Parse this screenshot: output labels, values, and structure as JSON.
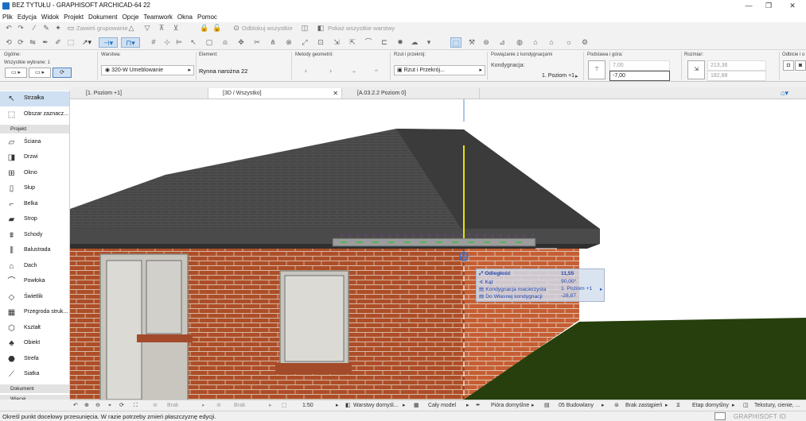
{
  "window": {
    "title": "BEZ TYTUŁU - GRAPHISOFT ARCHICAD-64 22",
    "minimize": "—",
    "maximize": "❐",
    "close": "✕"
  },
  "menu": [
    "Plik",
    "Edycja",
    "Widok",
    "Projekt",
    "Dokument",
    "Opcje",
    "Teamwork",
    "Okna",
    "Pomoc"
  ],
  "toolbar": {
    "group": "Zawieś grupowanie",
    "unlock": "Odblokuj wszystkie",
    "show_all_layers": "Pokaż wszystkie warstwy"
  },
  "infobox": {
    "general_label": "Ogólne:",
    "selected_label": "Wszystkie wybrane: 1",
    "layer_label": "Warstwa:",
    "layer_value": "320-W Umeblowanie",
    "element_label": "Element:",
    "element_value": "Rynna narożna 22",
    "geometry_label": "Metody geometrii:",
    "plan_label": "Rzut i przekrój:",
    "plan_value": "Rzut i Przekrój...",
    "story_link_label": "Powiązanie z kondygnacjami",
    "story_label": "Kondygnacja:",
    "story_value": "1. Poziom +1",
    "base_label": "Podstawa i góra:",
    "base_top": "7,00",
    "base_bottom": "-7,00",
    "size_label": "Rozmiar:",
    "size_w": "213,36",
    "size_h": "182,88",
    "offset_label": "Odbicie i o"
  },
  "toolbox": {
    "arrow": "Strzałka",
    "marquee": "Obszar zaznacz...",
    "section_project": "Projekt",
    "section_document": "Dokument",
    "section_more": "Więcej",
    "tools": [
      "Ściana",
      "Drzwi",
      "Okno",
      "Słup",
      "Belka",
      "Strop",
      "Schody",
      "Balustrada",
      "Dach",
      "Powłoka",
      "Świetlik",
      "Przegroda struk...",
      "Kształt",
      "Obiekt",
      "Strefa",
      "Siatka"
    ]
  },
  "tabs": [
    {
      "label": "[1. Poziom +1]"
    },
    {
      "label": "[3D / Wszystko]"
    },
    {
      "label": "[A.03.2.2 Poziom 0]"
    }
  ],
  "tracker": {
    "distance_label": "Odległość",
    "distance_value": "11,55",
    "angle_label": "Kąt",
    "angle_value": "90,00°",
    "parent_story_label": "Kondygnacja macierzysta",
    "parent_story_value": "1. Poziom +1",
    "to_story_label": "Do Własnej kondygnacji",
    "to_story_value": "-28,87"
  },
  "navbar": {
    "brak1": "Brak",
    "brak2": "Brak",
    "scale": "1:50",
    "layers": "Warstwy domyśl...",
    "model": "Cały model",
    "pens": "Pióra domyślne",
    "budowlany": "05 Budowlany",
    "override": "Brak zastąpień",
    "stage": "Etap domyślny",
    "textures": "Tekstury, cienie, ..."
  },
  "status": {
    "message": "Określ punkt docelowy przesunięcia. W razie potrzeby zmień płaszczyznę edycji.",
    "brand": "GRAPHISOFT ID"
  },
  "colors": {
    "accent": "#1b6fc2",
    "roof": "#3a3a3a",
    "brick": "#b4532b",
    "grass": "#2b4a0f",
    "tracker_text": "#2449b5"
  }
}
